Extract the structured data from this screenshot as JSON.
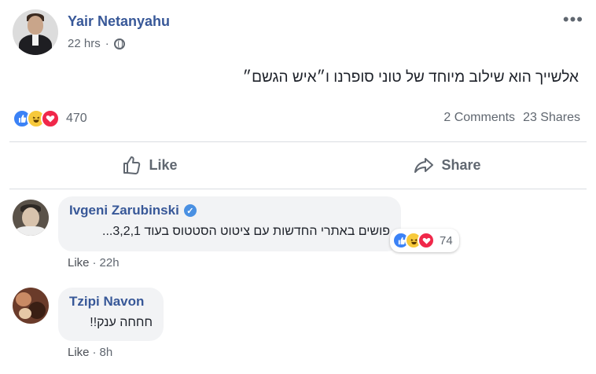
{
  "post": {
    "author": "Yair Netanyahu",
    "time": "22 hrs",
    "time_separator": "·",
    "more_label": "•••",
    "text": "אלשייך הוא שילוב מיוחד של טוני סופרנו ו״איש הגשם״",
    "reaction_count": "470",
    "comments_count": "2 Comments",
    "shares_count": "23 Shares"
  },
  "actions": {
    "like_label": "Like",
    "share_label": "Share"
  },
  "comments": [
    {
      "name": "Ivgeni Zarubinski",
      "verified": true,
      "text": "פושים באתרי החדשות עם ציטוט הסטטוס בעוד 3,2,1...",
      "reaction_count": "74",
      "like_label": "Like",
      "separator": "·",
      "time": "22h"
    },
    {
      "name": "Tzipi Navon",
      "verified": false,
      "text": "חחחה ענק!!",
      "like_label": "Like",
      "separator": "·",
      "time": "8h"
    }
  ],
  "colors": {
    "link": "#385898",
    "like": "#3b82f6",
    "haha": "#f7c93b",
    "love": "#f0284a",
    "secondary_text": "#606770"
  },
  "icons": [
    "globe-icon",
    "like-icon",
    "haha-icon",
    "love-icon",
    "thumbs-up-icon",
    "share-arrow-icon",
    "verified-icon",
    "more-icon"
  ]
}
